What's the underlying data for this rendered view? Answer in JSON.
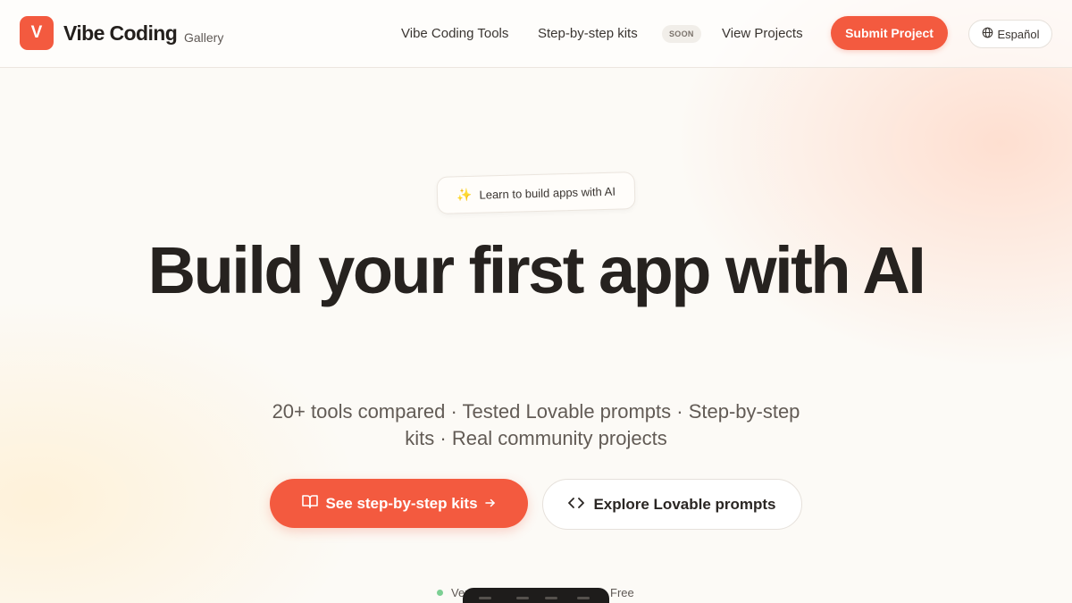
{
  "header": {
    "logo_letter": "V",
    "brand_name": "Vibe Coding",
    "brand_sub": "Gallery",
    "nav": [
      {
        "label": "Vibe Coding Tools"
      },
      {
        "label": "Step-by-step kits",
        "badge": "SOON"
      },
      {
        "label": "View Projects"
      }
    ],
    "submit_label": "Submit Project",
    "language_label": "Español",
    "language_icon": "globe-icon"
  },
  "hero": {
    "pill_icon": "sparkles-icon",
    "pill_label": "Learn to build apps with AI",
    "headline": "Build your first app with AI",
    "subline": "20+ tools compared · Tested Lovable prompts · Step-by-step kits · Real community projects",
    "cta_primary": {
      "label": "See step-by-step kits",
      "icon": "book-open-icon",
      "trailing_icon": "arrow-right-icon"
    },
    "cta_secondary": {
      "label": "Explore Lovable prompts",
      "icon": "code-brackets-icon"
    }
  },
  "footer_partial": {
    "left_text": "Ver",
    "right_text": "Free"
  },
  "colors": {
    "accent": "#f35a3f",
    "text_dark": "#26221f",
    "text_muted": "#625b55",
    "status_green": "#7ccf93"
  }
}
